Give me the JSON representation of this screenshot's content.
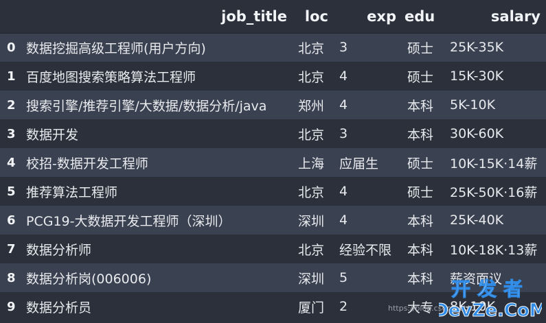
{
  "table": {
    "headers": {
      "index": "",
      "job_title": "job_title",
      "loc": "loc",
      "exp": "exp",
      "edu": "edu",
      "salary": "salary"
    },
    "rows": [
      {
        "index": "0",
        "job_title": "数据挖掘高级工程师(用户方向)",
        "loc": "北京",
        "exp": "3",
        "edu": "硕士",
        "salary": "25K-35K"
      },
      {
        "index": "1",
        "job_title": "百度地图搜索策略算法工程师",
        "loc": "北京",
        "exp": "4",
        "edu": "硕士",
        "salary": "15K-30K"
      },
      {
        "index": "2",
        "job_title": "搜索引擎/推荐引擎/大数据/数据分析/java",
        "loc": "郑州",
        "exp": "4",
        "edu": "本科",
        "salary": "5K-10K"
      },
      {
        "index": "3",
        "job_title": "数据开发",
        "loc": "北京",
        "exp": "3",
        "edu": "本科",
        "salary": "30K-60K"
      },
      {
        "index": "4",
        "job_title": "校招-数据开发工程师",
        "loc": "上海",
        "exp": "应届生",
        "edu": "硕士",
        "salary": "10K-15K·14薪"
      },
      {
        "index": "5",
        "job_title": "推荐算法工程师",
        "loc": "北京",
        "exp": "4",
        "edu": "硕士",
        "salary": "25K-50K·16薪"
      },
      {
        "index": "6",
        "job_title": "PCG19-大数据开发工程师（深圳）",
        "loc": "深圳",
        "exp": "4",
        "edu": "本科",
        "salary": "25K-40K"
      },
      {
        "index": "7",
        "job_title": "数据分析师",
        "loc": "北京",
        "exp": "经验不限",
        "edu": "本科",
        "salary": "10K-18K·13薪"
      },
      {
        "index": "8",
        "job_title": "数据分析岗(006006)",
        "loc": "深圳",
        "exp": "5",
        "edu": "本科",
        "salary": "薪资面议"
      },
      {
        "index": "9",
        "job_title": "数据分析员",
        "loc": "厦门",
        "exp": "2",
        "edu": "大专",
        "salary": "8K-10K"
      }
    ]
  },
  "watermark": {
    "text": "https://blog.csdn.net/...",
    "logo_top": "开发者",
    "logo_bottom": "DevZe.CoM"
  },
  "colors": {
    "background": "#2b303b",
    "row_stripe": "#3a4150",
    "text": "#e8eaee",
    "watermark_white": "#ffffff",
    "watermark_blue": "#2f8be6"
  }
}
